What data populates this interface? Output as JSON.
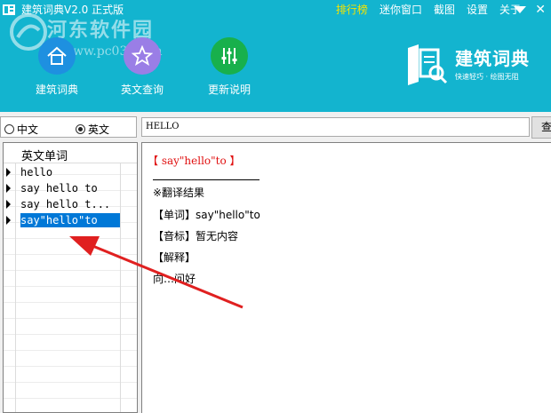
{
  "titlebar": {
    "app_title": "建筑词典V2.0 正式版",
    "links": [
      "排行榜",
      "迷你窗口",
      "截图",
      "设置",
      "关于"
    ],
    "close_glyph": "✕"
  },
  "watermark": {
    "text": "河东软件园",
    "url": "www.pc0359.cn"
  },
  "toolbar": {
    "buttons": [
      {
        "label": "建筑词典",
        "icon": "home-icon"
      },
      {
        "label": "英文查询",
        "icon": "star-icon"
      },
      {
        "label": "更新说明",
        "icon": "equalizer-icon"
      }
    ]
  },
  "brand": {
    "name": "建筑词典",
    "slogan": "快速轻巧 · 绘图无阻"
  },
  "lang": {
    "option_cn": "中文",
    "option_en": "英文",
    "selected": "英文"
  },
  "search": {
    "value": "HELLO",
    "button_label": "查"
  },
  "word_list": {
    "header": "英文单词",
    "items": [
      "hello",
      "say hello to",
      "say hello t...",
      "say\"hello\"to"
    ],
    "selected_index": 3
  },
  "detail": {
    "title": "【 say\"hello\"to 】",
    "result_heading": "※翻译结果",
    "word_line": "【单词】say\"hello\"to",
    "phonetic_line": "【音标】暂无内容",
    "explain_heading": "【解释】",
    "explain_text": "向…问好"
  },
  "colors": {
    "header_bg": "#13b4cf",
    "active_link": "#f5e400",
    "title_red": "#e01010",
    "selection": "#0078d7",
    "annotation_arrow": "#e02020"
  }
}
